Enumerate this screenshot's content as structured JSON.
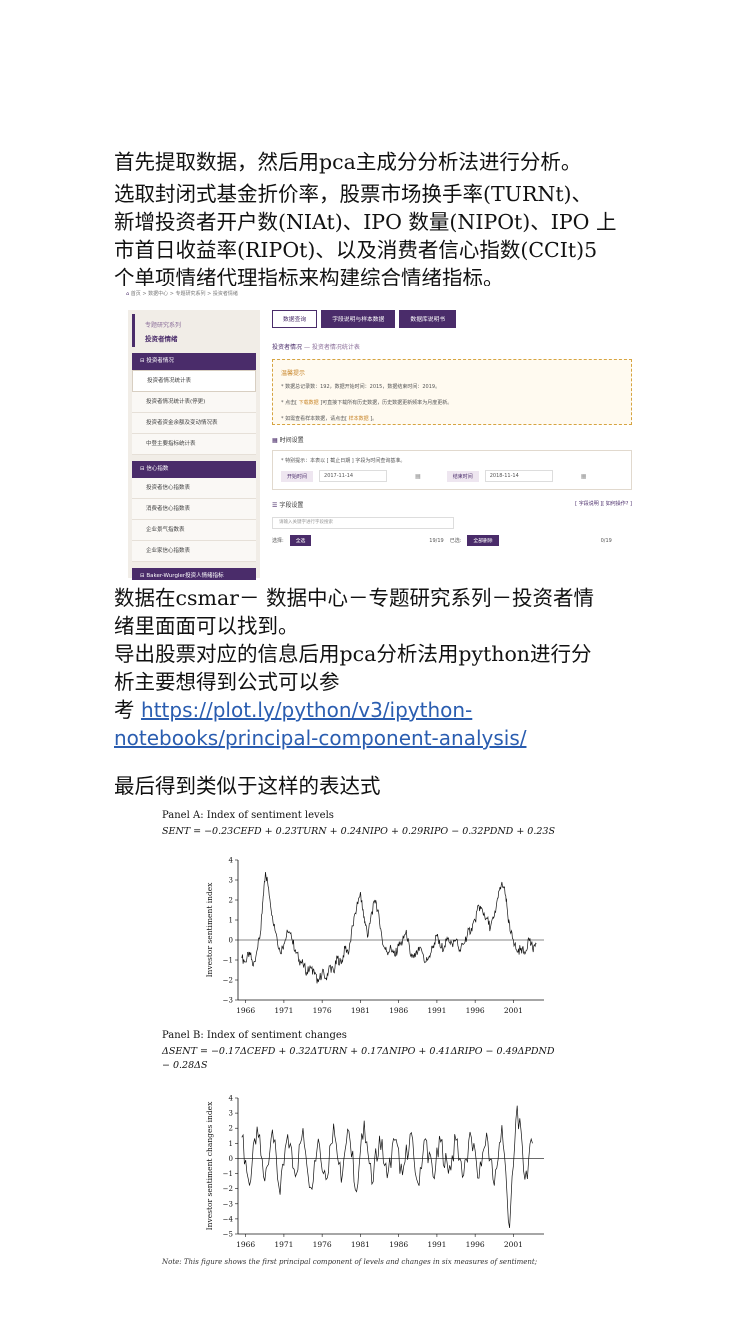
{
  "article": {
    "p1": "首先提取数据，然后用pca主成分分析法进行分析。",
    "p2_lines": [
      "选取封闭式基金折价率，股票市场换手率(TURNt)、",
      "新增投资者开户数(NIAt)、IPO 数量(NIPOt)、IPO 上",
      "市首日收益率(RIPOt)、以及消费者信心指数(CCIt)5",
      "个单项情绪代理指标来构建综合情绪指标。"
    ],
    "p3_line1": "数据在csmar－ 数据中心－专题研究系列－投资者情",
    "p3_line2": "绪里面面可以找到。",
    "p3_line3": "导出股票对应的信息后用pca分析法用python进行分",
    "p3_line4_chars": [
      "析",
      "主",
      "要",
      "想",
      "得",
      "到",
      "公",
      "式",
      "可",
      "以",
      "参"
    ],
    "p3_line5_word": "考",
    "link_part1": "https://plot.ly/python/v3/ipython-",
    "link_part2": "notebooks/principal-component-analysis/",
    "p4": "最后得到类似于这样的表达式"
  },
  "csmar": {
    "breadcrumb": "首页 > 数据中心 > 专题研究系列 > 投资者情绪",
    "sidebar": {
      "series": "专题研究系列",
      "title": "投资者情绪",
      "groups": [
        {
          "label": "投资者情况",
          "items": [
            "投资者情况统计表",
            "投资者情况统计表(停更)",
            "投资者资金余额及变动情况表",
            "中登主要指标统计表"
          ]
        },
        {
          "label": "信心指数",
          "items": [
            "投资者信心指数表",
            "消费者信心指数表",
            "企业景气指数表",
            "企业家信心指数表"
          ]
        },
        {
          "label": "Baker-Wurgler投资人情绪指标",
          "items": []
        }
      ]
    },
    "tabs": [
      "数据查询",
      "字段说明与样本数据",
      "数据库说明书"
    ],
    "table_title": "投资者情况",
    "table_subtitle": "投资者情况统计表",
    "notice": {
      "heading": "温馨提示",
      "line1": "* 数据总记录数：192，数据开始时间：2015，数据结束时间：2019。",
      "line2_pre": "* 点击[",
      "line2_hl": " 下载数据 ",
      "line2_post": "]可直接下载所有历史数据，历史数据更新频率为月度更新。",
      "line3_pre": "* 如需查看样本数据，请点击[",
      "line3_hl": " 样本数据 ",
      "line3_post": "]。"
    },
    "time_section": "时间设置",
    "time_hint": "* 特别提示：本表以 [ 截止日期 ] 字段为时间查询基准。",
    "start_label": "开始时间",
    "start_value": "2017-11-14",
    "end_label": "结束时间",
    "end_value": "2018-11-14",
    "field_section": "字段设置",
    "field_links": "[ 字段说明 ][ 如何操作? ]",
    "search_placeholder": "请输入关键字进行字段搜索",
    "select_label": "选择:",
    "select_all": "全选",
    "count_left": "19/19",
    "selected_label": "已选:",
    "remove_all": "全部删除",
    "count_right": "0/19"
  },
  "figure": {
    "panel_a_title": "Panel A: Index of sentiment levels",
    "panel_a_eq": "SENT = −0.23CEFD + 0.23TURN + 0.24NIPO + 0.29RIPO − 0.32PDND + 0.23S",
    "panel_b_title": "Panel B: Index of sentiment changes",
    "panel_b_eq": "ΔSENT = −0.17ΔCEFD + 0.32ΔTURN + 0.17ΔNIPO + 0.41ΔRIPO − 0.49ΔPDND",
    "panel_b_eq2": "− 0.28ΔS",
    "note": "Note: This figure shows the first principal component of levels and changes in six measures of sentiment;"
  },
  "chart_data": [
    {
      "type": "line",
      "title": "Panel A: Index of sentiment levels",
      "xlabel": "",
      "ylabel": "Investor sentiment index",
      "xlim": [
        1965,
        2005
      ],
      "ylim": [
        -3,
        4
      ],
      "x_ticks": [
        "1966",
        "1971",
        "1976",
        "1981",
        "1986",
        "1991",
        "1996",
        "2001"
      ],
      "y_ticks": [
        "-3",
        "-2",
        "-1",
        "0",
        "1",
        "2",
        "3",
        "4"
      ],
      "series": [
        {
          "x": [
            1965.5,
            1966,
            1966.5,
            1967,
            1967.5,
            1968,
            1968.3,
            1968.6,
            1969,
            1969.5,
            1970,
            1970.5,
            1971,
            1971.5,
            1972,
            1972.5,
            1973,
            1973.5,
            1974,
            1974.5,
            1975,
            1975.5,
            1976,
            1976.5,
            1977,
            1977.5,
            1978,
            1978.5,
            1979,
            1979.5,
            1980,
            1980.5,
            1981,
            1981.3,
            1981.6,
            1982,
            1982.5,
            1983,
            1983.5,
            1984,
            1984.5,
            1985,
            1985.5,
            1986,
            1986.5,
            1987,
            1987.5,
            1988,
            1988.5,
            1989,
            1989.5,
            1990,
            1990.5,
            1991,
            1991.5,
            1992,
            1992.5,
            1993,
            1993.5,
            1994,
            1994.5,
            1995,
            1995.5,
            1996,
            1996.5,
            1997,
            1997.5,
            1998,
            1998.5,
            1999,
            1999.5,
            2000,
            2000.3,
            2000.6,
            2001,
            2001.5,
            2002,
            2002.5,
            2003,
            2003.5,
            2004
          ],
          "y": [
            -0.9,
            -1.1,
            -0.6,
            -1.3,
            -0.5,
            0.5,
            2.2,
            3.4,
            2.6,
            1.2,
            0.3,
            -0.6,
            -0.2,
            0.4,
            0.1,
            -0.5,
            -1.0,
            -1.2,
            -1.6,
            -1.4,
            -1.7,
            -2.1,
            -1.6,
            -1.9,
            -1.3,
            -1.6,
            -0.9,
            -1.2,
            -0.4,
            -0.6,
            0.7,
            1.6,
            2.4,
            1.5,
            0.9,
            0.2,
            1.4,
            2.0,
            0.9,
            -0.3,
            -0.6,
            -0.4,
            -0.8,
            -0.3,
            -0.1,
            0.5,
            -0.7,
            -0.9,
            -0.6,
            -0.5,
            -1.1,
            -0.8,
            -0.3,
            0.2,
            -0.4,
            -0.3,
            0.1,
            -0.2,
            0.0,
            -0.5,
            -0.2,
            0.3,
            0.6,
            1.0,
            1.7,
            1.4,
            1.1,
            0.6,
            1.2,
            2.1,
            2.9,
            2.2,
            1.1,
            0.4,
            0.0,
            -0.6,
            -0.4,
            -0.7,
            0.1,
            -0.4,
            -0.2
          ]
        }
      ]
    },
    {
      "type": "line",
      "title": "Panel B: Index of sentiment changes",
      "xlabel": "",
      "ylabel": "Investor sentiment changes index",
      "xlim": [
        1965,
        2005
      ],
      "ylim": [
        -5,
        4
      ],
      "x_ticks": [
        "1966",
        "1971",
        "1976",
        "1981",
        "1986",
        "1991",
        "1996",
        "2001"
      ],
      "y_ticks": [
        "-5",
        "-4",
        "-3",
        "-2",
        "-1",
        "0",
        "1",
        "2",
        "3",
        "4"
      ],
      "series": [
        {
          "x": [
            1965.5,
            1966.5,
            1967.5,
            1968.5,
            1969.5,
            1970.5,
            1971.5,
            1972.5,
            1973.5,
            1974.5,
            1975.5,
            1976.5,
            1977.5,
            1978.5,
            1979.5,
            1980.5,
            1981.5,
            1982.5,
            1983.5,
            1984.5,
            1985.5,
            1986.5,
            1987.5,
            1988.5,
            1989.5,
            1990.5,
            1991.5,
            1992.5,
            1993.5,
            1994.5,
            1995.5,
            1996.5,
            1997.5,
            1998.5,
            1999.5,
            2000.5,
            2001.5,
            2002.5,
            2003.5
          ],
          "y": [
            1.4,
            -1.8,
            2.1,
            -1.5,
            1.9,
            -2.4,
            1.6,
            -1.2,
            2.0,
            -1.9,
            1.3,
            -1.4,
            2.3,
            -1.6,
            1.8,
            -2.2,
            2.5,
            -1.7,
            1.5,
            -1.3,
            1.2,
            -1.1,
            1.6,
            -1.6,
            1.3,
            -1.2,
            1.1,
            -1.0,
            1.2,
            -1.1,
            1.4,
            -1.3,
            1.7,
            -1.8,
            2.2,
            -4.6,
            3.5,
            -1.4,
            1.0
          ]
        }
      ]
    }
  ]
}
